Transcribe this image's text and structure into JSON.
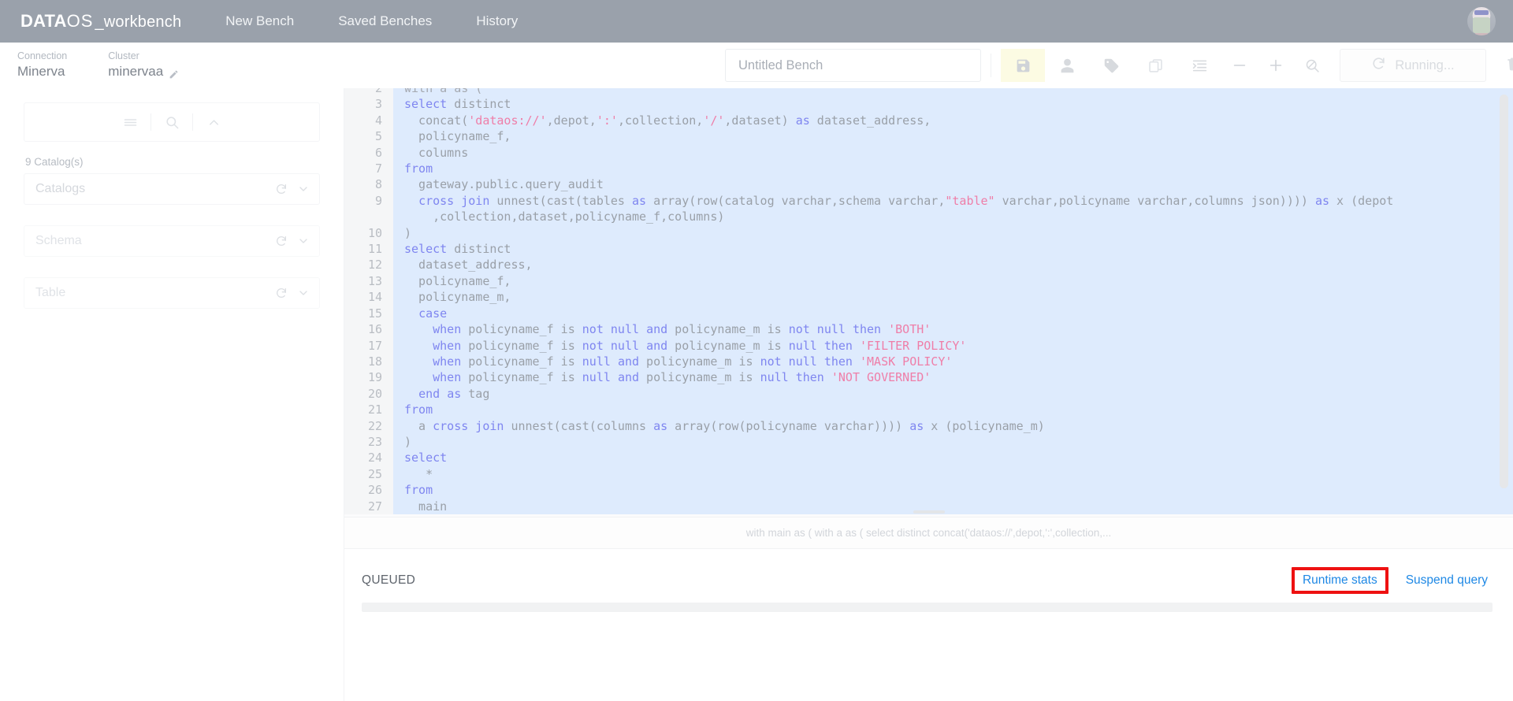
{
  "app": {
    "brand_data": "DATA",
    "brand_os": "OS",
    "brand_suffix": "_workbench"
  },
  "topnav": {
    "links": [
      {
        "label": "New Bench",
        "name": "nav-new-bench"
      },
      {
        "label": "Saved Benches",
        "name": "nav-saved-benches"
      },
      {
        "label": "History",
        "name": "nav-history"
      }
    ],
    "avatar_name": "user-avatar"
  },
  "subheader": {
    "connection_label": "Connection",
    "connection_value": "Minerva",
    "cluster_label": "Cluster",
    "cluster_value": "minervaa"
  },
  "toolbar": {
    "bench_name_value": "",
    "bench_name_placeholder": "Untitled Bench",
    "save_title": "Save",
    "person_title": "Share",
    "tag_title": "Tag",
    "copy_title": "Copy",
    "format_title": "Format",
    "zoom_out_title": "Zoom out",
    "zoom_in_title": "Zoom in",
    "search_off_title": "Search off",
    "run_label": "Running...",
    "delete_title": "Delete"
  },
  "sidebar": {
    "menu_icon": "menu-icon",
    "search_icon": "search-icon",
    "collapse_icon": "chevron-up-icon",
    "catalog_count": "9 Catalog(s)",
    "selectors": [
      {
        "label": "Catalogs",
        "name": "catalogs-select"
      },
      {
        "label": "Schema",
        "name": "schema-select"
      },
      {
        "label": "Table",
        "name": "table-select"
      }
    ]
  },
  "editor": {
    "lines": [
      {
        "num": "2",
        "partial": true,
        "tokens": [
          {
            "t": "with a as (",
            "c": "p"
          }
        ]
      },
      {
        "num": "3",
        "tokens": [
          {
            "t": "select",
            "c": "k"
          },
          {
            "t": " distinct",
            "c": ""
          }
        ]
      },
      {
        "num": "4",
        "tokens": [
          {
            "t": "  concat(",
            "c": ""
          },
          {
            "t": "'dataos://'",
            "c": "s"
          },
          {
            "t": ",depot,",
            "c": ""
          },
          {
            "t": "':'",
            "c": "s"
          },
          {
            "t": ",collection,",
            "c": ""
          },
          {
            "t": "'/'",
            "c": "s"
          },
          {
            "t": ",dataset) ",
            "c": ""
          },
          {
            "t": "as",
            "c": "k"
          },
          {
            "t": " dataset_address,",
            "c": ""
          }
        ]
      },
      {
        "num": "5",
        "tokens": [
          {
            "t": "  policyname_f,",
            "c": ""
          }
        ]
      },
      {
        "num": "6",
        "tokens": [
          {
            "t": "  columns",
            "c": ""
          }
        ]
      },
      {
        "num": "7",
        "tokens": [
          {
            "t": "from",
            "c": "k"
          }
        ]
      },
      {
        "num": "8",
        "tokens": [
          {
            "t": "  gateway.public.query_audit",
            "c": ""
          }
        ]
      },
      {
        "num": "9",
        "tokens": [
          {
            "t": "  ",
            "c": ""
          },
          {
            "t": "cross join",
            "c": "k"
          },
          {
            "t": " unnest(cast(tables ",
            "c": ""
          },
          {
            "t": "as",
            "c": "k"
          },
          {
            "t": " array(row(catalog varchar,schema varchar,",
            "c": ""
          },
          {
            "t": "\"table\"",
            "c": "s"
          },
          {
            "t": " varchar,policyname varchar,columns json)))) ",
            "c": ""
          },
          {
            "t": "as",
            "c": "k"
          },
          {
            "t": " x (depot",
            "c": ""
          }
        ]
      },
      {
        "num": "",
        "tokens": [
          {
            "t": "    ,collection,dataset,policyname_f,columns)",
            "c": ""
          }
        ]
      },
      {
        "num": "10",
        "tokens": [
          {
            "t": ")",
            "c": ""
          }
        ]
      },
      {
        "num": "11",
        "tokens": [
          {
            "t": "select",
            "c": "k"
          },
          {
            "t": " distinct",
            "c": ""
          }
        ]
      },
      {
        "num": "12",
        "tokens": [
          {
            "t": "  dataset_address,",
            "c": ""
          }
        ]
      },
      {
        "num": "13",
        "tokens": [
          {
            "t": "  policyname_f,",
            "c": ""
          }
        ]
      },
      {
        "num": "14",
        "tokens": [
          {
            "t": "  policyname_m,",
            "c": ""
          }
        ]
      },
      {
        "num": "15",
        "tokens": [
          {
            "t": "  ",
            "c": ""
          },
          {
            "t": "case",
            "c": "k"
          }
        ]
      },
      {
        "num": "16",
        "tokens": [
          {
            "t": "    ",
            "c": ""
          },
          {
            "t": "when",
            "c": "k"
          },
          {
            "t": " policyname_f is ",
            "c": ""
          },
          {
            "t": "not null",
            "c": "k"
          },
          {
            "t": " ",
            "c": ""
          },
          {
            "t": "and",
            "c": "k"
          },
          {
            "t": " policyname_m is ",
            "c": ""
          },
          {
            "t": "not null",
            "c": "k"
          },
          {
            "t": " ",
            "c": ""
          },
          {
            "t": "then",
            "c": "k"
          },
          {
            "t": " ",
            "c": ""
          },
          {
            "t": "'BOTH'",
            "c": "s"
          }
        ]
      },
      {
        "num": "17",
        "tokens": [
          {
            "t": "    ",
            "c": ""
          },
          {
            "t": "when",
            "c": "k"
          },
          {
            "t": " policyname_f is ",
            "c": ""
          },
          {
            "t": "not null",
            "c": "k"
          },
          {
            "t": " ",
            "c": ""
          },
          {
            "t": "and",
            "c": "k"
          },
          {
            "t": " policyname_m is ",
            "c": ""
          },
          {
            "t": "null",
            "c": "k"
          },
          {
            "t": " ",
            "c": ""
          },
          {
            "t": "then",
            "c": "k"
          },
          {
            "t": " ",
            "c": ""
          },
          {
            "t": "'FILTER POLICY'",
            "c": "s"
          }
        ]
      },
      {
        "num": "18",
        "tokens": [
          {
            "t": "    ",
            "c": ""
          },
          {
            "t": "when",
            "c": "k"
          },
          {
            "t": " policyname_f is ",
            "c": ""
          },
          {
            "t": "null",
            "c": "k"
          },
          {
            "t": " ",
            "c": ""
          },
          {
            "t": "and",
            "c": "k"
          },
          {
            "t": " policyname_m is ",
            "c": ""
          },
          {
            "t": "not null",
            "c": "k"
          },
          {
            "t": " ",
            "c": ""
          },
          {
            "t": "then",
            "c": "k"
          },
          {
            "t": " ",
            "c": ""
          },
          {
            "t": "'MASK POLICY'",
            "c": "s"
          }
        ]
      },
      {
        "num": "19",
        "tokens": [
          {
            "t": "    ",
            "c": ""
          },
          {
            "t": "when",
            "c": "k"
          },
          {
            "t": " policyname_f is ",
            "c": ""
          },
          {
            "t": "null",
            "c": "k"
          },
          {
            "t": " ",
            "c": ""
          },
          {
            "t": "and",
            "c": "k"
          },
          {
            "t": " policyname_m is ",
            "c": ""
          },
          {
            "t": "null",
            "c": "k"
          },
          {
            "t": " ",
            "c": ""
          },
          {
            "t": "then",
            "c": "k"
          },
          {
            "t": " ",
            "c": ""
          },
          {
            "t": "'NOT GOVERNED'",
            "c": "s"
          }
        ]
      },
      {
        "num": "20",
        "tokens": [
          {
            "t": "  ",
            "c": ""
          },
          {
            "t": "end",
            "c": "k"
          },
          {
            "t": " ",
            "c": ""
          },
          {
            "t": "as",
            "c": "k"
          },
          {
            "t": " tag",
            "c": ""
          }
        ]
      },
      {
        "num": "21",
        "tokens": [
          {
            "t": "from",
            "c": "k"
          }
        ]
      },
      {
        "num": "22",
        "tokens": [
          {
            "t": "  a ",
            "c": ""
          },
          {
            "t": "cross join",
            "c": "k"
          },
          {
            "t": " unnest(cast(columns ",
            "c": ""
          },
          {
            "t": "as",
            "c": "k"
          },
          {
            "t": " array(row(policyname varchar)))) ",
            "c": ""
          },
          {
            "t": "as",
            "c": "k"
          },
          {
            "t": " x (policyname_m)",
            "c": ""
          }
        ]
      },
      {
        "num": "23",
        "tokens": [
          {
            "t": ")",
            "c": ""
          }
        ]
      },
      {
        "num": "24",
        "tokens": [
          {
            "t": "select",
            "c": "k"
          }
        ]
      },
      {
        "num": "25",
        "tokens": [
          {
            "t": "   *",
            "c": ""
          }
        ]
      },
      {
        "num": "26",
        "tokens": [
          {
            "t": "from",
            "c": "k"
          }
        ]
      },
      {
        "num": "27",
        "tokens": [
          {
            "t": "  main",
            "c": ""
          }
        ]
      }
    ],
    "status_strip": "with main as ( with a as ( select distinct concat('dataos://',depot,':',collection,..."
  },
  "results": {
    "status": "QUEUED",
    "runtime_stats_label": "Runtime stats",
    "suspend_query_label": "Suspend query",
    "highlight_color": "#ee1111",
    "link_color": "#1e88e5"
  }
}
